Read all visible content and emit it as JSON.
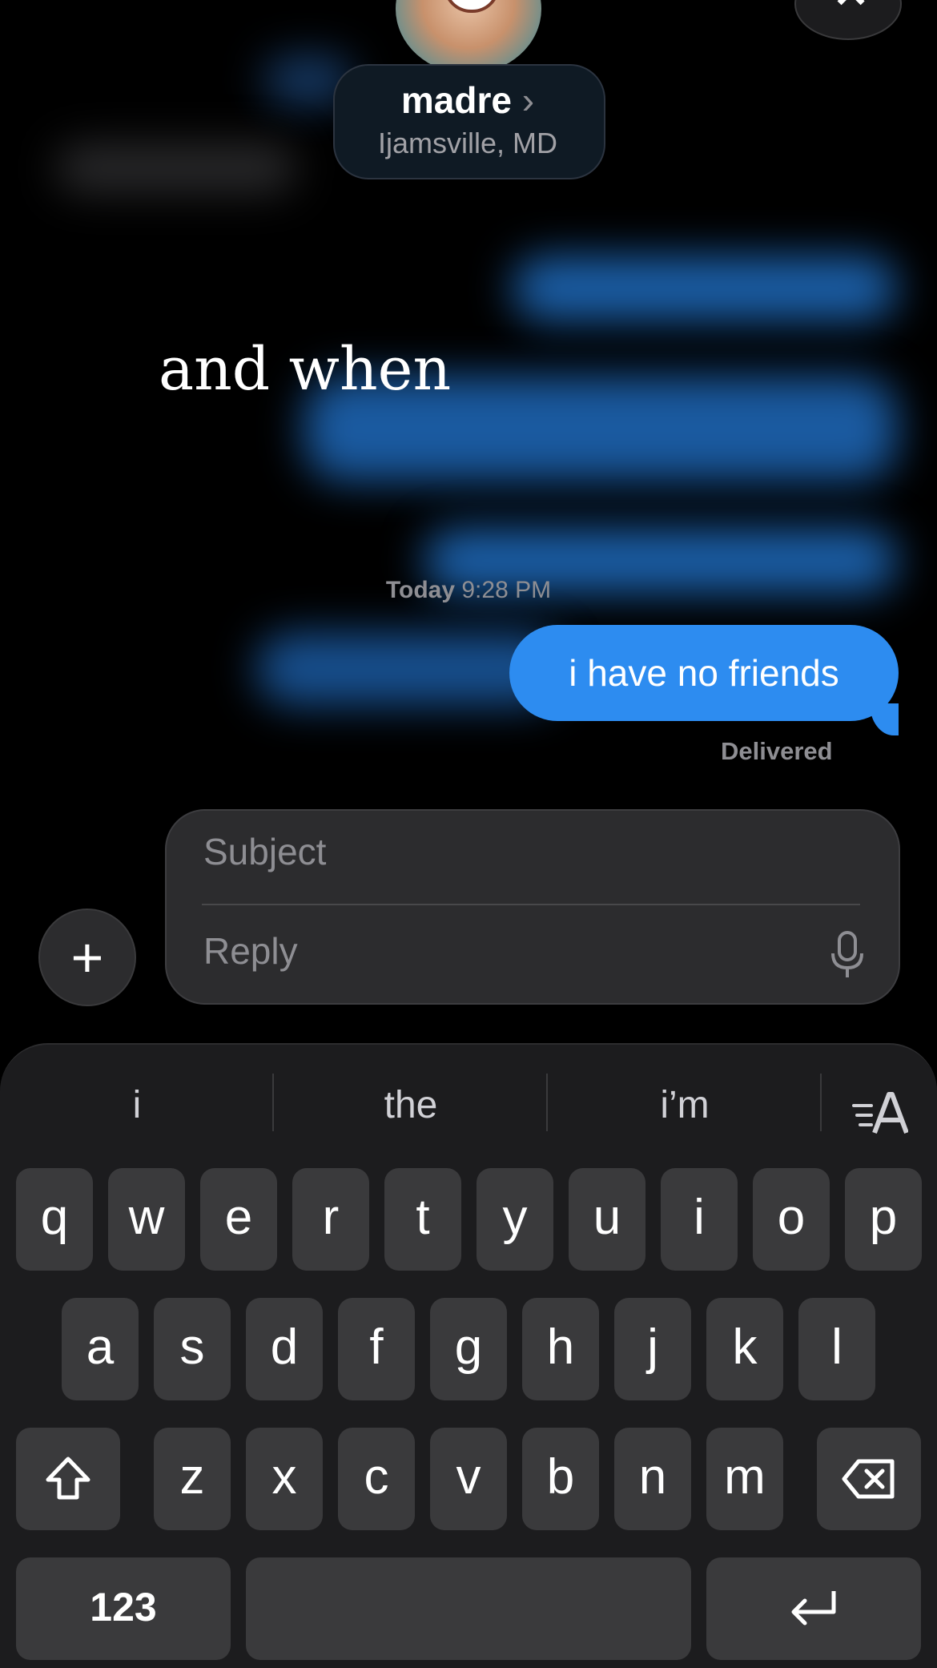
{
  "header": {
    "contact_name": "madre",
    "contact_chevron": "›",
    "contact_location": "Ijamsville, MD",
    "close_icon": "close-icon",
    "close_glyph": "✕"
  },
  "thread": {
    "effect_text": "and when",
    "timestamp_day": "Today",
    "timestamp_time": "9:28 PM",
    "last_message": "i have no friends",
    "status": "Delivered"
  },
  "compose": {
    "plus_glyph": "+",
    "subject_placeholder": "Subject",
    "reply_placeholder": "Reply"
  },
  "keyboard": {
    "suggestions": [
      "i",
      "the",
      "i’m"
    ],
    "row1": [
      "q",
      "w",
      "e",
      "r",
      "t",
      "y",
      "u",
      "i",
      "o",
      "p"
    ],
    "row2": [
      "a",
      "s",
      "d",
      "f",
      "g",
      "h",
      "j",
      "k",
      "l"
    ],
    "row3": [
      "z",
      "x",
      "c",
      "v",
      "b",
      "n",
      "m"
    ],
    "numbers_label": "123"
  },
  "colors": {
    "bubble_blue": "#2d8cf0",
    "background": "#000000",
    "keyboard_bg": "#1c1c1e",
    "key_bg": "#3a3a3c"
  }
}
